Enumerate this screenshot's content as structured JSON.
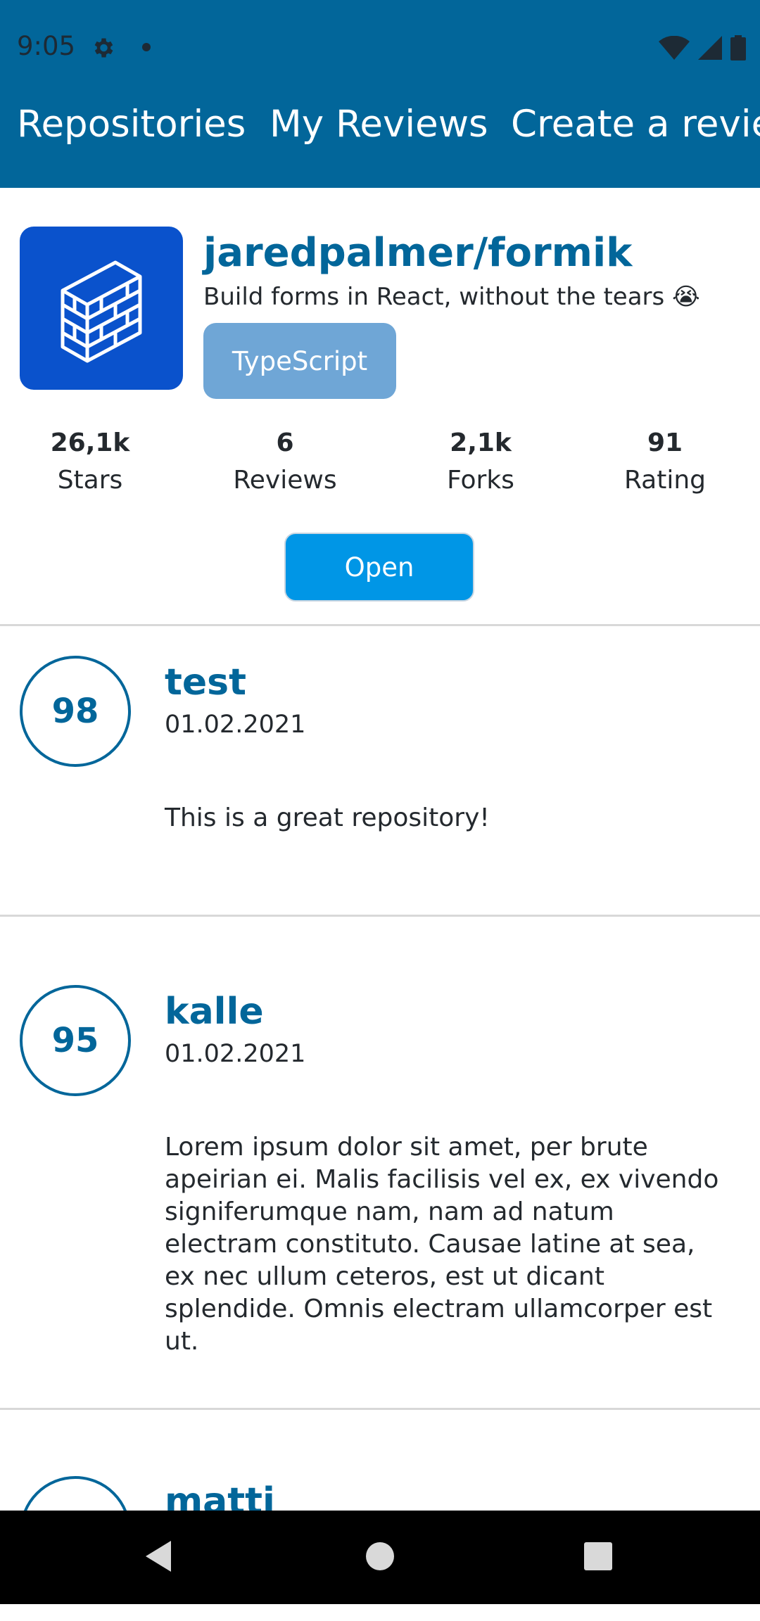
{
  "status_bar": {
    "time": "9:05",
    "icons": [
      "gear-icon",
      "notification-dot",
      "wifi-icon",
      "signal-icon",
      "battery-icon"
    ]
  },
  "app_bar": {
    "tabs": [
      {
        "label": "Repositories"
      },
      {
        "label": "My Reviews"
      },
      {
        "label": "Create a review"
      }
    ]
  },
  "repository": {
    "full_name": "jaredpalmer/formik",
    "description": "Build forms in React, without the tears 😭",
    "language": "TypeScript",
    "stats": [
      {
        "value": "26,1k",
        "label": "Stars"
      },
      {
        "value": "6",
        "label": "Reviews"
      },
      {
        "value": "2,1k",
        "label": "Forks"
      },
      {
        "value": "91",
        "label": "Rating"
      }
    ],
    "open_label": "Open"
  },
  "reviews": [
    {
      "rating": "98",
      "username": "test",
      "date": "01.02.2021",
      "text": "This is a great repository!"
    },
    {
      "rating": "95",
      "username": "kalle",
      "date": "01.02.2021",
      "text": "Lorem ipsum dolor sit amet, per brute apeirian ei. Malis facilisis vel ex, ex vivendo signiferumque nam, nam ad natum electram constituto. Causae latine at sea, ex nec ullum ceteros, est ut dicant splendide. Omnis electram ullamcorper est ut."
    },
    {
      "rating": "",
      "username": "matti",
      "date": "",
      "text": ""
    }
  ],
  "colors": {
    "primary": "#02669a",
    "language_badge": "#6fa6d6",
    "open_button": "#0096e6",
    "avatar_bg": "#0a52cc"
  }
}
